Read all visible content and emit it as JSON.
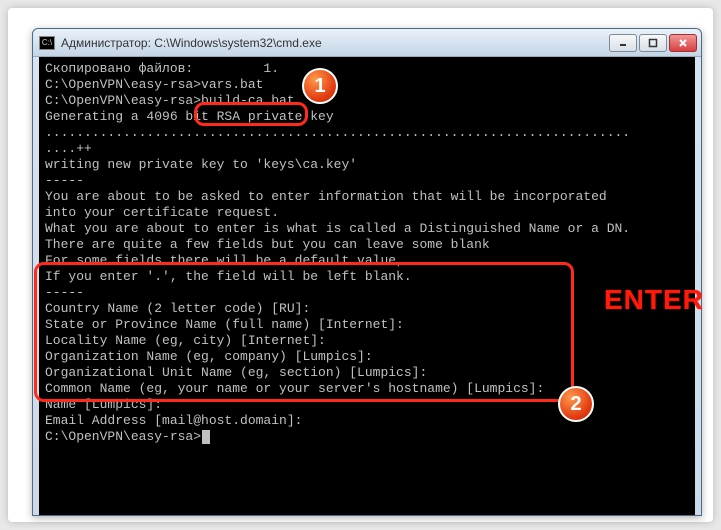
{
  "window": {
    "title": "Администратор: C:\\Windows\\system32\\cmd.exe",
    "icon_label": "C:\\"
  },
  "console": {
    "lines": [
      "Скопировано файлов:         1.",
      "",
      "C:\\OpenVPN\\easy-rsa>vars.bat",
      "",
      "C:\\OpenVPN\\easy-rsa>build-ca.bat",
      "Generating a 4096 bit RSA private key",
      "...........................................................................",
      "....++",
      "writing new private key to 'keys\\ca.key'",
      "-----",
      "You are about to be asked to enter information that will be incorporated",
      "into your certificate request.",
      "What you are about to enter is what is called a Distinguished Name or a DN.",
      "There are quite a few fields but you can leave some blank",
      "For some fields there will be a default value,",
      "If you enter '.', the field will be left blank.",
      "-----",
      "Country Name (2 letter code) [RU]:",
      "State or Province Name (full name) [Internet]:",
      "Locality Name (eg, city) [Internet]:",
      "Organization Name (eg, company) [Lumpics]:",
      "Organizational Unit Name (eg, section) [Lumpics]:",
      "Common Name (eg, your name or your server's hostname) [Lumpics]:",
      "Name [Lumpics]:",
      "Email Address [mail@host.domain]:",
      "",
      "C:\\OpenVPN\\easy-rsa>"
    ]
  },
  "annotations": {
    "badge1": "1",
    "badge2": "2",
    "enter_label": "ENTER",
    "highlighted_command": "build-ca.bat"
  }
}
